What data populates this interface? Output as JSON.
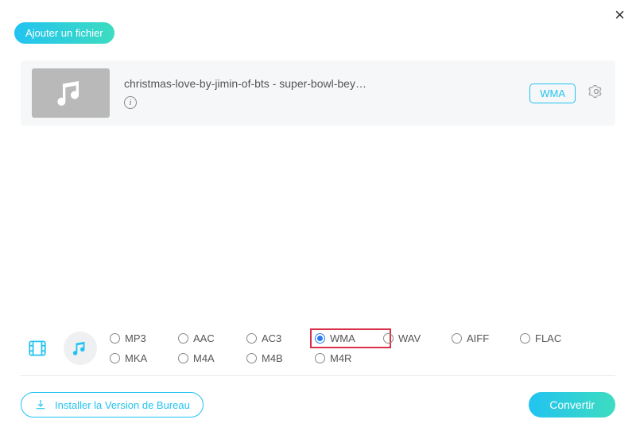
{
  "header": {
    "add_file_label": "Ajouter un fichier"
  },
  "file": {
    "title": "christmas-love-by-jimin-of-bts - super-bowl-bey…",
    "format_badge": "WMA"
  },
  "formats": {
    "row1": [
      "MP3",
      "AAC",
      "AC3",
      "WMA",
      "WAV",
      "AIFF",
      "FLAC"
    ],
    "row2": [
      "MKA",
      "M4A",
      "M4B",
      "M4R"
    ],
    "selected": "WMA"
  },
  "footer": {
    "install_label": "Installer la Version de Bureau",
    "convert_label": "Convertir"
  }
}
